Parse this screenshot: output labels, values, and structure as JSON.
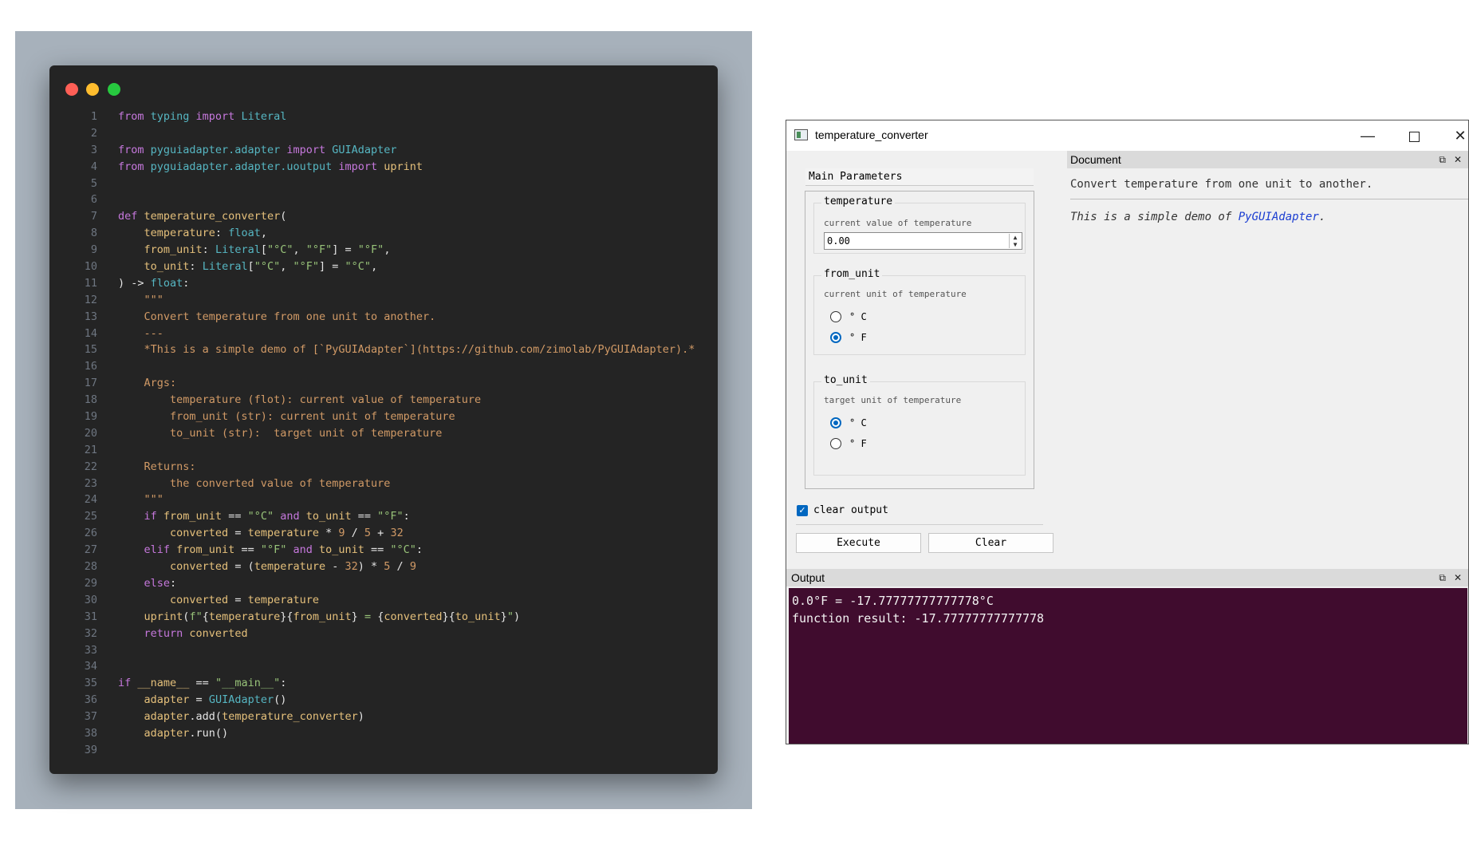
{
  "code": {
    "traffic_lights": [
      "#ff5f56",
      "#ffbd2e",
      "#27c93f"
    ],
    "lines": [
      {
        "n": "1",
        "t": [
          [
            "kw",
            "from "
          ],
          [
            "ty",
            "typing "
          ],
          [
            "kw",
            "import "
          ],
          [
            "ty",
            "Literal"
          ]
        ]
      },
      {
        "n": "2",
        "t": []
      },
      {
        "n": "3",
        "t": [
          [
            "kw",
            "from "
          ],
          [
            "ty",
            "pyguiadapter.adapter "
          ],
          [
            "kw",
            "import "
          ],
          [
            "ty",
            "GUIAdapter"
          ]
        ]
      },
      {
        "n": "4",
        "t": [
          [
            "kw",
            "from "
          ],
          [
            "ty",
            "pyguiadapter.adapter.uoutput "
          ],
          [
            "kw",
            "import "
          ],
          [
            "fn",
            "uprint"
          ]
        ]
      },
      {
        "n": "5",
        "t": []
      },
      {
        "n": "6",
        "t": []
      },
      {
        "n": "7",
        "t": [
          [
            "kw",
            "def "
          ],
          [
            "fn",
            "temperature_converter"
          ],
          [
            "pl",
            "("
          ]
        ]
      },
      {
        "n": "8",
        "t": [
          [
            "pl",
            "    "
          ],
          [
            "fn",
            "temperature"
          ],
          [
            "pl",
            ": "
          ],
          [
            "ty",
            "float"
          ],
          [
            "pl",
            ","
          ]
        ]
      },
      {
        "n": "9",
        "t": [
          [
            "pl",
            "    "
          ],
          [
            "fn",
            "from_unit"
          ],
          [
            "pl",
            ": "
          ],
          [
            "ty",
            "Literal"
          ],
          [
            "pl",
            "["
          ],
          [
            "st",
            "\"°C\""
          ],
          [
            "pl",
            ", "
          ],
          [
            "st",
            "\"°F\""
          ],
          [
            "pl",
            "] = "
          ],
          [
            "st",
            "\"°F\""
          ],
          [
            "pl",
            ","
          ]
        ]
      },
      {
        "n": "10",
        "t": [
          [
            "pl",
            "    "
          ],
          [
            "fn",
            "to_unit"
          ],
          [
            "pl",
            ": "
          ],
          [
            "ty",
            "Literal"
          ],
          [
            "pl",
            "["
          ],
          [
            "st",
            "\"°C\""
          ],
          [
            "pl",
            ", "
          ],
          [
            "st",
            "\"°F\""
          ],
          [
            "pl",
            "] = "
          ],
          [
            "st",
            "\"°C\""
          ],
          [
            "pl",
            ","
          ]
        ]
      },
      {
        "n": "11",
        "t": [
          [
            "pl",
            ") -> "
          ],
          [
            "ty",
            "float"
          ],
          [
            "pl",
            ":"
          ]
        ]
      },
      {
        "n": "12",
        "t": [
          [
            "ds",
            "    \"\"\""
          ]
        ]
      },
      {
        "n": "13",
        "t": [
          [
            "ds",
            "    Convert temperature from one unit to another."
          ]
        ]
      },
      {
        "n": "14",
        "t": [
          [
            "ds",
            "    ---"
          ]
        ]
      },
      {
        "n": "15",
        "t": [
          [
            "ds",
            "    *This is a simple demo of [`PyGUIAdapter`](https://github.com/zimolab/PyGUIAdapter).*"
          ]
        ]
      },
      {
        "n": "16",
        "t": []
      },
      {
        "n": "17",
        "t": [
          [
            "ds",
            "    Args:"
          ]
        ]
      },
      {
        "n": "18",
        "t": [
          [
            "ds",
            "        temperature (flot): current value of temperature"
          ]
        ]
      },
      {
        "n": "19",
        "t": [
          [
            "ds",
            "        from_unit (str): current unit of temperature"
          ]
        ]
      },
      {
        "n": "20",
        "t": [
          [
            "ds",
            "        to_unit (str):  target unit of temperature"
          ]
        ]
      },
      {
        "n": "21",
        "t": []
      },
      {
        "n": "22",
        "t": [
          [
            "ds",
            "    Returns:"
          ]
        ]
      },
      {
        "n": "23",
        "t": [
          [
            "ds",
            "        the converted value of temperature"
          ]
        ]
      },
      {
        "n": "24",
        "t": [
          [
            "ds",
            "    \"\"\""
          ]
        ]
      },
      {
        "n": "25",
        "t": [
          [
            "pl",
            "    "
          ],
          [
            "kw",
            "if "
          ],
          [
            "fn",
            "from_unit"
          ],
          [
            "pl",
            " == "
          ],
          [
            "st",
            "\"°C\" "
          ],
          [
            "kw",
            "and "
          ],
          [
            "fn",
            "to_unit"
          ],
          [
            "pl",
            " == "
          ],
          [
            "st",
            "\"°F\""
          ],
          [
            "pl",
            ":"
          ]
        ]
      },
      {
        "n": "26",
        "t": [
          [
            "pl",
            "        "
          ],
          [
            "fn",
            "converted"
          ],
          [
            "pl",
            " = "
          ],
          [
            "fn",
            "temperature"
          ],
          [
            "pl",
            " * "
          ],
          [
            "nu",
            "9"
          ],
          [
            "pl",
            " / "
          ],
          [
            "nu",
            "5"
          ],
          [
            "pl",
            " + "
          ],
          [
            "nu",
            "32"
          ]
        ]
      },
      {
        "n": "27",
        "t": [
          [
            "pl",
            "    "
          ],
          [
            "kw",
            "elif "
          ],
          [
            "fn",
            "from_unit"
          ],
          [
            "pl",
            " == "
          ],
          [
            "st",
            "\"°F\" "
          ],
          [
            "kw",
            "and "
          ],
          [
            "fn",
            "to_unit"
          ],
          [
            "pl",
            " == "
          ],
          [
            "st",
            "\"°C\""
          ],
          [
            "pl",
            ":"
          ]
        ]
      },
      {
        "n": "28",
        "t": [
          [
            "pl",
            "        "
          ],
          [
            "fn",
            "converted"
          ],
          [
            "pl",
            " = ("
          ],
          [
            "fn",
            "temperature"
          ],
          [
            "pl",
            " - "
          ],
          [
            "nu",
            "32"
          ],
          [
            "pl",
            ") * "
          ],
          [
            "nu",
            "5"
          ],
          [
            "pl",
            " / "
          ],
          [
            "nu",
            "9"
          ]
        ]
      },
      {
        "n": "29",
        "t": [
          [
            "pl",
            "    "
          ],
          [
            "kw",
            "else"
          ],
          [
            "pl",
            ":"
          ]
        ]
      },
      {
        "n": "30",
        "t": [
          [
            "pl",
            "        "
          ],
          [
            "fn",
            "converted"
          ],
          [
            "pl",
            " = "
          ],
          [
            "fn",
            "temperature"
          ]
        ]
      },
      {
        "n": "31",
        "t": [
          [
            "pl",
            "    "
          ],
          [
            "fn",
            "uprint"
          ],
          [
            "pl",
            "("
          ],
          [
            "st",
            "f\""
          ],
          [
            "pl",
            "{"
          ],
          [
            "fn",
            "temperature"
          ],
          [
            "pl",
            "}{"
          ],
          [
            "fn",
            "from_unit"
          ],
          [
            "pl",
            "} "
          ],
          [
            "st",
            "= "
          ],
          [
            "pl",
            "{"
          ],
          [
            "fn",
            "converted"
          ],
          [
            "pl",
            "}{"
          ],
          [
            "fn",
            "to_unit"
          ],
          [
            "pl",
            "}"
          ],
          [
            "st",
            "\""
          ],
          [
            "pl",
            ")"
          ]
        ]
      },
      {
        "n": "32",
        "t": [
          [
            "pl",
            "    "
          ],
          [
            "kw",
            "return "
          ],
          [
            "fn",
            "converted"
          ]
        ]
      },
      {
        "n": "33",
        "t": []
      },
      {
        "n": "34",
        "t": []
      },
      {
        "n": "35",
        "t": [
          [
            "kw",
            "if "
          ],
          [
            "fn",
            "__name__"
          ],
          [
            "pl",
            " == "
          ],
          [
            "st",
            "\"__main__\""
          ],
          [
            "pl",
            ":"
          ]
        ]
      },
      {
        "n": "36",
        "t": [
          [
            "pl",
            "    "
          ],
          [
            "fn",
            "adapter"
          ],
          [
            "pl",
            " = "
          ],
          [
            "ty",
            "GUIAdapter"
          ],
          [
            "pl",
            "()"
          ]
        ]
      },
      {
        "n": "37",
        "t": [
          [
            "pl",
            "    "
          ],
          [
            "fn",
            "adapter"
          ],
          [
            "pl",
            ".add("
          ],
          [
            "fn",
            "temperature_converter"
          ],
          [
            "pl",
            ")"
          ]
        ]
      },
      {
        "n": "38",
        "t": [
          [
            "pl",
            "    "
          ],
          [
            "fn",
            "adapter"
          ],
          [
            "pl",
            ".run()"
          ]
        ]
      },
      {
        "n": "39",
        "t": []
      }
    ]
  },
  "window": {
    "title": "temperature_converter",
    "minimize_icon": "minimize-icon",
    "maximize_icon": "maximize-icon",
    "close_icon": "close-icon"
  },
  "params": {
    "tab_label": "Main Parameters",
    "temperature": {
      "title": "temperature",
      "description": "current value of temperature",
      "value": "0.00"
    },
    "from_unit": {
      "title": "from_unit",
      "description": "current unit of temperature",
      "options": [
        "° C",
        "° F"
      ],
      "selected": "° F"
    },
    "to_unit": {
      "title": "to_unit",
      "description": "target unit of temperature",
      "options": [
        "° C",
        "° F"
      ],
      "selected": "° C"
    }
  },
  "controls": {
    "clear_output_label": "clear output",
    "clear_output_checked": true,
    "execute_label": "Execute",
    "clear_label": "Clear"
  },
  "document": {
    "header": "Document",
    "line1": "Convert temperature from one unit to another.",
    "line2_prefix": "This is a simple demo of ",
    "link_text": "PyGUIAdapter",
    "line2_suffix": "."
  },
  "output": {
    "header": "Output",
    "lines": [
      "0.0°F = -17.77777777777778°C",
      "function result: -17.77777777777778"
    ],
    "background": "#400c2e"
  }
}
